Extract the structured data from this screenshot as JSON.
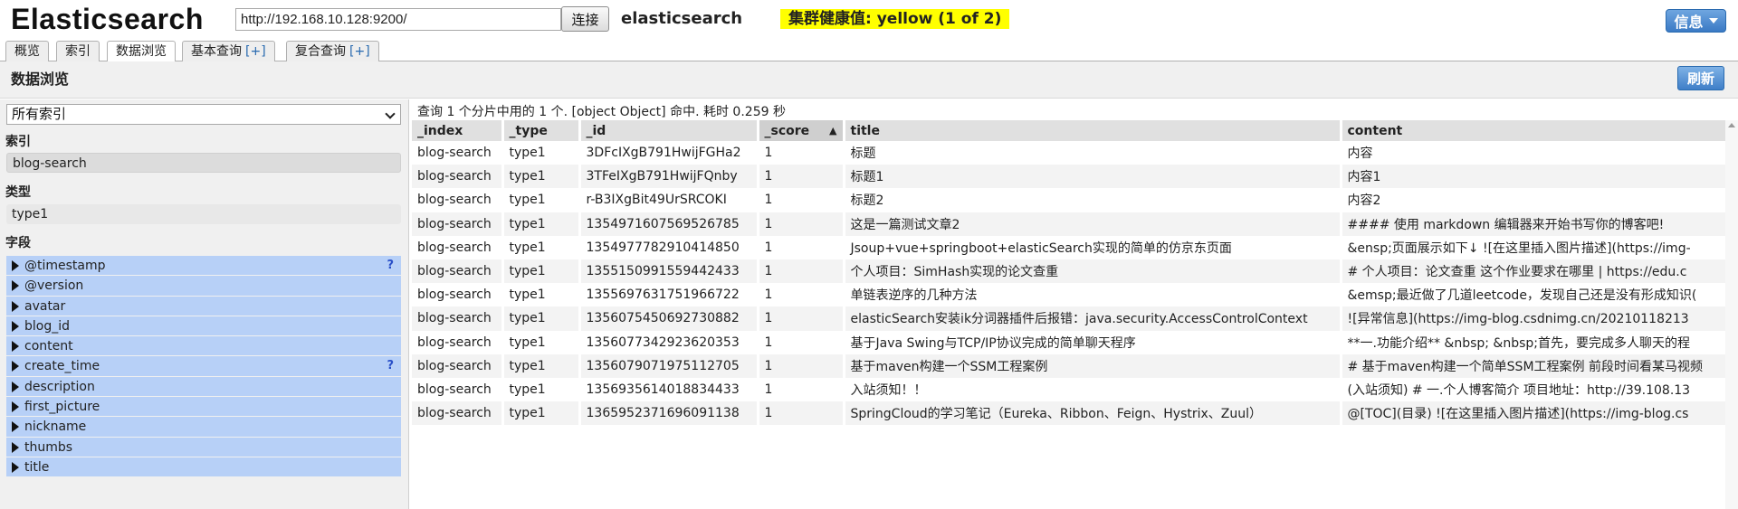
{
  "header": {
    "app_title": "Elasticsearch",
    "url": "http://192.168.10.128:9200/",
    "connect_label": "连接",
    "cluster_name": "elasticsearch",
    "cluster_health": "集群健康值: yellow (1 of 2)",
    "info_label": "信息",
    "health_color": "#ffff00"
  },
  "tabs": [
    {
      "label": "概览",
      "plus": ""
    },
    {
      "label": "索引",
      "plus": ""
    },
    {
      "label": "数据浏览",
      "plus": "",
      "active": true
    },
    {
      "label": "基本查询",
      "plus": "[+]"
    },
    {
      "label": "复合查询",
      "plus": "[+]"
    }
  ],
  "section": {
    "title": "数据浏览",
    "refresh_label": "刷新"
  },
  "sidebar": {
    "index_select_value": "所有索引",
    "index_heading": "索引",
    "index_value": "blog-search",
    "type_heading": "类型",
    "type_value": "type1",
    "fields_heading": "字段",
    "fields": [
      {
        "name": "@timestamp",
        "help": "?"
      },
      {
        "name": "@version",
        "help": ""
      },
      {
        "name": "avatar",
        "help": ""
      },
      {
        "name": "blog_id",
        "help": ""
      },
      {
        "name": "content",
        "help": ""
      },
      {
        "name": "create_time",
        "help": "?"
      },
      {
        "name": "description",
        "help": ""
      },
      {
        "name": "first_picture",
        "help": ""
      },
      {
        "name": "nickname",
        "help": ""
      },
      {
        "name": "thumbs",
        "help": ""
      },
      {
        "name": "title",
        "help": ""
      }
    ]
  },
  "results": {
    "summary": "查询 1 个分片中用的 1 个. [object Object] 命中. 耗时 0.259 秒",
    "columns": [
      "_index",
      "_type",
      "_id",
      "_score",
      "title",
      "content"
    ],
    "sorted_column": "_score",
    "sort_arrow": "▲",
    "rows": [
      [
        "blog-search",
        "type1",
        "3DFcIXgB791HwijFGHa2",
        "1",
        "标题",
        "内容"
      ],
      [
        "blog-search",
        "type1",
        "3TFeIXgB791HwijFQnby",
        "1",
        "标题1",
        "内容1"
      ],
      [
        "blog-search",
        "type1",
        "r-B3IXgBit49UrSRCOKI",
        "1",
        "标题2",
        "内容2"
      ],
      [
        "blog-search",
        "type1",
        "1354971607569526785",
        "1",
        "这是一篇测试文章2",
        "#### 使用 markdown 编辑器来开始书写你的博客吧!"
      ],
      [
        "blog-search",
        "type1",
        "1354977782910414850",
        "1",
        "Jsoup+vue+springboot+elasticSearch实现的简单的仿京东页面",
        "&ensp;页面展示如下↓ ![在这里插入图片描述](https://img-"
      ],
      [
        "blog-search",
        "type1",
        "1355150991559442433",
        "1",
        "个人项目：SimHash实现的论文查重",
        "# 个人项目：论文查重 这个作业要求在哪里 | https://edu.c"
      ],
      [
        "blog-search",
        "type1",
        "1355697631751966722",
        "1",
        "单链表逆序的几种方法",
        "&emsp;最近做了几道leetcode，发现自己还是没有形成知识("
      ],
      [
        "blog-search",
        "type1",
        "1356075450692730882",
        "1",
        "elasticSearch安装ik分词器插件后报错：java.security.AccessControlContext",
        "![异常信息](https://img-blog.csdnimg.cn/20210118213"
      ],
      [
        "blog-search",
        "type1",
        "1356077342923620353",
        "1",
        "基于Java Swing与TCP/IP协议完成的简单聊天程序",
        "**一.功能介绍** &nbsp; &nbsp;首先，要完成多人聊天的程"
      ],
      [
        "blog-search",
        "type1",
        "1356079071975112705",
        "1",
        "基于maven构建一个SSM工程案例",
        "# 基于maven构建一个简单SSM工程案例 前段时间看某马视频"
      ],
      [
        "blog-search",
        "type1",
        "1356935614018834433",
        "1",
        "入站须知！！",
        "(入站须知) # 一.个人博客简介 项目地址：http://39.108.13"
      ],
      [
        "blog-search",
        "type1",
        "1365952371696091138",
        "1",
        "SpringCloud的学习笔记（Eureka、Ribbon、Feign、Hystrix、Zuul）",
        "@[TOC](目录) ![在这里插入图片描述](https://img-blog.cs"
      ]
    ]
  }
}
